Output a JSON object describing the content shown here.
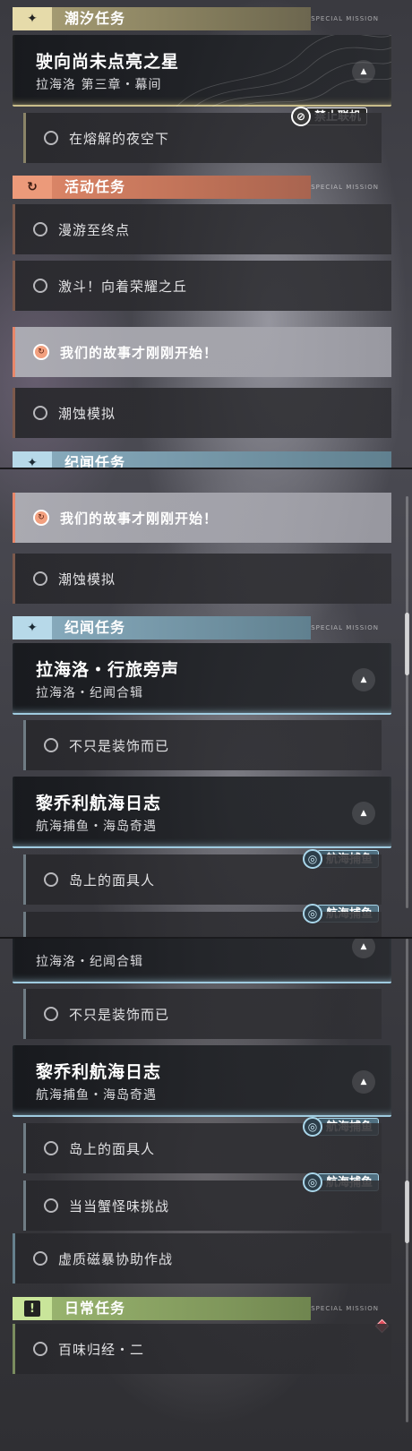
{
  "categories": {
    "tide": "潮汐任务",
    "event": "活动任务",
    "story": "纪闻任务",
    "daily": "日常任务",
    "deco_text": "SPECIAL MISSION"
  },
  "icons": {
    "tide": "sparkle-icon",
    "event": "refresh-arrow-icon",
    "story": "sparkle-icon",
    "daily": "exclamation-icon",
    "collapse": "triangle-up-icon"
  },
  "tide_group": {
    "name": "驶向尚未点亮之星",
    "sub": "拉海洛 第三章・幕间",
    "tag": "禁止联机",
    "items": [
      "在熔解的夜空下"
    ]
  },
  "event_items": [
    "漫游至终点",
    "激斗！向着荣耀之丘",
    "我们的故事才刚刚开始！",
    "潮蚀模拟"
  ],
  "story_groups": [
    {
      "name": "拉海洛・行旅旁声",
      "sub": "拉海洛・纪闻合辑",
      "items": [
        "不只是装饰而已"
      ]
    },
    {
      "name": "黎乔利航海日志",
      "sub": "航海捕鱼・海岛奇遇",
      "tag": "航海捕鱼",
      "items": [
        "岛上的面具人",
        "当当蟹怪味挑战"
      ]
    }
  ],
  "story_items": [
    "虚质磁暴协助作战"
  ],
  "daily_items": [
    "百味归经・二"
  ],
  "colors": {
    "tide": "#e6dbaa",
    "event": "#ec9a7a",
    "story": "#b7d9e9",
    "daily": "#c9e59a",
    "active_item": "#a8a8b0"
  }
}
